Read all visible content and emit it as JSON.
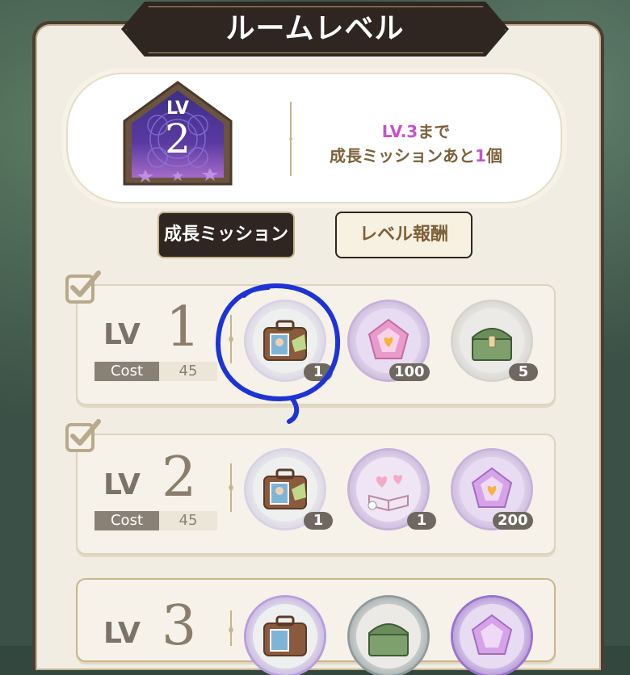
{
  "title": "ルームレベル",
  "level": {
    "label": "LV",
    "value": "2",
    "info_line1_prefix": "LV.3",
    "info_line1_suffix": "まで",
    "info_line2_prefix": "成長ミッションあと",
    "info_line2_count": "1",
    "info_line2_suffix": "個"
  },
  "tabs": [
    {
      "label": "成長ミッション",
      "active": true
    },
    {
      "label": "レベル報酬",
      "active": false
    }
  ],
  "rows": [
    {
      "lv_label": "LV",
      "lv_num": "1",
      "cost_label": "Cost",
      "cost_value": "45",
      "completed": true,
      "rewards": [
        {
          "icon": "suitcase-icon",
          "count": "1"
        },
        {
          "icon": "pink-gem-icon",
          "count": "100"
        },
        {
          "icon": "green-chest-icon",
          "count": "5"
        }
      ]
    },
    {
      "lv_label": "LV",
      "lv_num": "2",
      "cost_label": "Cost",
      "cost_value": "45",
      "completed": true,
      "rewards": [
        {
          "icon": "suitcase-icon",
          "count": "1"
        },
        {
          "icon": "story-book-icon",
          "count": "1"
        },
        {
          "icon": "heart-gem-icon",
          "count": "200"
        }
      ]
    },
    {
      "lv_label": "LV",
      "lv_num": "3",
      "completed": false,
      "rewards": [
        {
          "icon": "suitcase-icon"
        },
        {
          "icon": "green-chest-icon"
        },
        {
          "icon": "heart-gem-icon"
        }
      ]
    }
  ],
  "colors": {
    "accent_pink": "#c553ca",
    "text_brown": "#7c6139",
    "dark_banner": "#2f2622",
    "annotation_blue": "#1d33d6"
  }
}
